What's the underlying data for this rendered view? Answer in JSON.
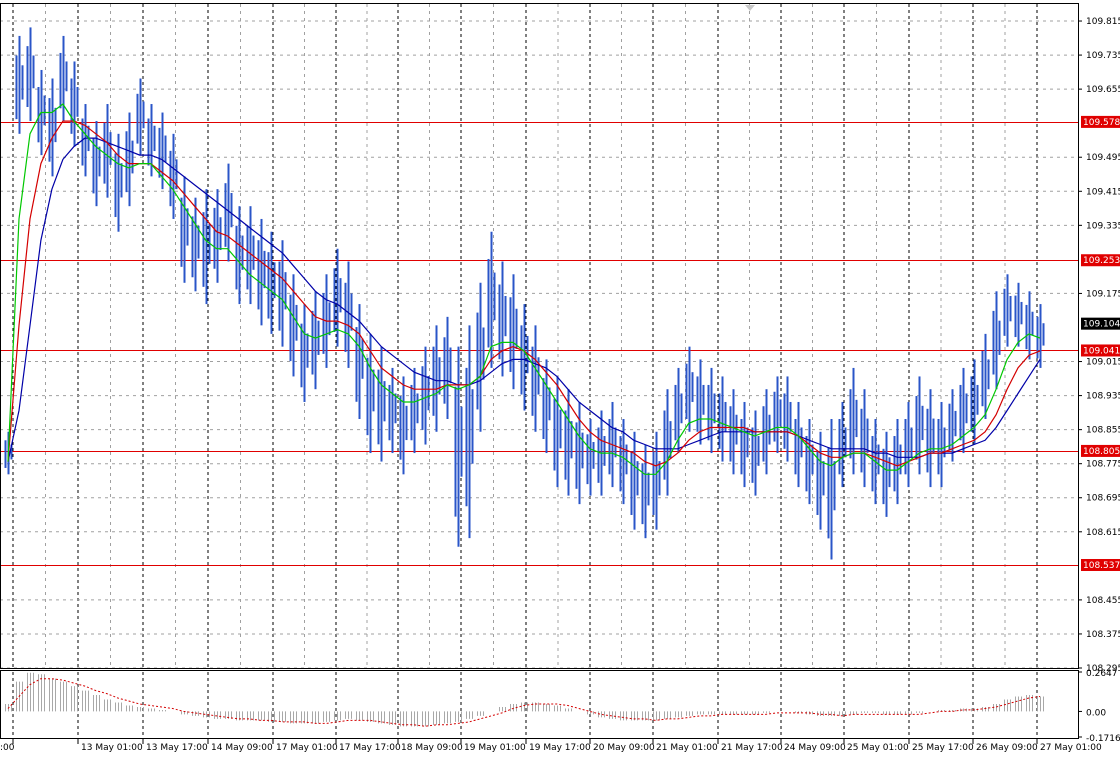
{
  "colors": {
    "background": "#ffffff",
    "frame": "#000000",
    "grid": "#a0a0a0",
    "candle_body": "#2a55c8",
    "ma_fast": "#00c800",
    "ma_medium": "#d40000",
    "ma_slow": "#0000a8",
    "level_line": "#e00000",
    "level_label_bg": "#e00000",
    "level_label_text": "#ffffff",
    "current_price_bg": "#000000",
    "current_price_text": "#ffffff",
    "histogram": "#a8a8a8",
    "signal": "#d40000"
  },
  "chart_data": [
    {
      "type": "line",
      "description_type": "candlestick price chart with three moving averages and horizontal levels",
      "ylim": [
        108.295,
        109.855
      ],
      "y_ticks": [
        "109.815",
        "109.735",
        "109.655",
        "109.495",
        "109.415",
        "109.335",
        "109.175",
        "109.015",
        "108.935",
        "108.855",
        "108.775",
        "108.695",
        "108.615",
        "108.455",
        "108.375",
        "108.295"
      ],
      "x_ticks": [
        ":00",
        "13 May 01:00",
        "13 May 17:00",
        "14 May 09:00",
        "17 May 01:00",
        "17 May 17:00",
        "18 May 09:00",
        "19 May 01:00",
        "19 May 17:00",
        "20 May 09:00",
        "21 May 01:00",
        "21 May 17:00",
        "24 May 09:00",
        "25 May 01:00",
        "25 May 17:00",
        "26 May 09:00",
        "27 May 01:00"
      ],
      "grid": true,
      "levels": [
        {
          "label": "109.578",
          "value": 109.578
        },
        {
          "label": "109.253",
          "value": 109.253
        },
        {
          "label": "109.041",
          "value": 109.041
        },
        {
          "label": "108.805",
          "value": 108.805
        },
        {
          "label": "108.537",
          "value": 108.537
        }
      ],
      "current_price": {
        "label": "109.104",
        "value": 109.104
      },
      "close": [
        108.78,
        109.6,
        109.68,
        109.62,
        109.58,
        109.7,
        109.64,
        109.55,
        109.5,
        109.52,
        109.42,
        109.48,
        109.6,
        109.55,
        109.52,
        109.48,
        109.35,
        109.3,
        109.3,
        109.32,
        109.38,
        109.3,
        109.28,
        109.25,
        109.22,
        109.18,
        109.1,
        109.05,
        109.1,
        109.15,
        109.2,
        109.15,
        109.05,
        108.95,
        108.9,
        108.92,
        108.88,
        108.9,
        108.95,
        108.98,
        109.0,
        108.92,
        108.95,
        109.05,
        109.2,
        109.15,
        109.1,
        109.05,
        108.98,
        108.92,
        108.88,
        108.85,
        108.8,
        108.78,
        108.8,
        108.82,
        108.78,
        108.75,
        108.7,
        108.72,
        108.8,
        108.9,
        108.95,
        108.92,
        108.9,
        108.88,
        108.85,
        108.83,
        108.82,
        108.85,
        108.9,
        108.88,
        108.82,
        108.78,
        108.75,
        108.77,
        108.82,
        108.85,
        108.82,
        108.76,
        108.73,
        108.75,
        108.8,
        108.85,
        108.82,
        108.8,
        108.84,
        108.88,
        108.9,
        108.95,
        109.05,
        109.15,
        109.12,
        109.08,
        109.06
      ],
      "ma_fast": [
        108.78,
        109.35,
        109.55,
        109.6,
        109.6,
        109.62,
        109.58,
        109.55,
        109.52,
        109.5,
        109.48,
        109.47,
        109.48,
        109.48,
        109.45,
        109.42,
        109.38,
        109.34,
        109.3,
        109.28,
        109.28,
        109.25,
        109.22,
        109.2,
        109.18,
        109.16,
        109.12,
        109.08,
        109.07,
        109.08,
        109.09,
        109.08,
        109.05,
        109.0,
        108.96,
        108.94,
        108.92,
        108.92,
        108.93,
        108.94,
        108.96,
        108.95,
        108.96,
        108.98,
        109.05,
        109.06,
        109.06,
        109.04,
        109.0,
        108.96,
        108.92,
        108.88,
        108.84,
        108.81,
        108.8,
        108.8,
        108.79,
        108.77,
        108.75,
        108.75,
        108.78,
        108.83,
        108.87,
        108.88,
        108.88,
        108.87,
        108.86,
        108.85,
        108.84,
        108.85,
        108.86,
        108.86,
        108.84,
        108.81,
        108.78,
        108.77,
        108.79,
        108.8,
        108.8,
        108.78,
        108.76,
        108.76,
        108.78,
        108.8,
        108.81,
        108.81,
        108.82,
        108.84,
        108.86,
        108.89,
        108.95,
        109.02,
        109.06,
        109.08,
        109.07
      ],
      "ma_medium": [
        108.78,
        109.1,
        109.35,
        109.48,
        109.54,
        109.58,
        109.58,
        109.57,
        109.55,
        109.53,
        109.5,
        109.48,
        109.48,
        109.48,
        109.46,
        109.44,
        109.41,
        109.38,
        109.35,
        109.32,
        109.31,
        109.29,
        109.27,
        109.25,
        109.23,
        109.21,
        109.18,
        109.15,
        109.12,
        109.11,
        109.11,
        109.1,
        109.08,
        109.04,
        109.0,
        108.98,
        108.96,
        108.95,
        108.95,
        108.95,
        108.96,
        108.96,
        108.96,
        108.98,
        109.02,
        109.04,
        109.05,
        109.04,
        109.02,
        108.99,
        108.96,
        108.92,
        108.88,
        108.85,
        108.83,
        108.82,
        108.81,
        108.8,
        108.78,
        108.77,
        108.78,
        108.8,
        108.83,
        108.85,
        108.86,
        108.86,
        108.86,
        108.86,
        108.85,
        108.85,
        108.85,
        108.85,
        108.84,
        108.82,
        108.8,
        108.79,
        108.79,
        108.8,
        108.8,
        108.79,
        108.78,
        108.77,
        108.78,
        108.79,
        108.8,
        108.8,
        108.81,
        108.82,
        108.83,
        108.85,
        108.89,
        108.95,
        109.0,
        109.03,
        109.04
      ],
      "ma_slow": [
        108.78,
        108.9,
        109.1,
        109.3,
        109.42,
        109.49,
        109.52,
        109.54,
        109.54,
        109.53,
        109.52,
        109.51,
        109.5,
        109.5,
        109.49,
        109.47,
        109.45,
        109.43,
        109.41,
        109.39,
        109.37,
        109.35,
        109.33,
        109.31,
        109.29,
        109.27,
        109.24,
        109.21,
        109.18,
        109.16,
        109.15,
        109.13,
        109.11,
        109.08,
        109.05,
        109.03,
        109.01,
        108.99,
        108.98,
        108.97,
        108.97,
        108.96,
        108.96,
        108.97,
        108.99,
        109.01,
        109.02,
        109.02,
        109.01,
        109.0,
        108.98,
        108.95,
        108.92,
        108.9,
        108.88,
        108.86,
        108.85,
        108.83,
        108.82,
        108.81,
        108.81,
        108.81,
        108.82,
        108.83,
        108.84,
        108.85,
        108.85,
        108.85,
        108.85,
        108.85,
        108.85,
        108.85,
        108.84,
        108.83,
        108.82,
        108.81,
        108.81,
        108.81,
        108.81,
        108.8,
        108.8,
        108.79,
        108.79,
        108.79,
        108.8,
        108.8,
        108.8,
        108.81,
        108.82,
        108.83,
        108.86,
        108.9,
        108.94,
        108.98,
        109.02
      ],
      "candle_range": [
        [
          108.75,
          108.85
        ],
        [
          109.55,
          109.78
        ],
        [
          109.58,
          109.8
        ],
        [
          109.5,
          109.7
        ],
        [
          109.45,
          109.68
        ],
        [
          109.58,
          109.78
        ],
        [
          109.52,
          109.72
        ],
        [
          109.45,
          109.62
        ],
        [
          109.38,
          109.58
        ],
        [
          109.4,
          109.62
        ],
        [
          109.32,
          109.55
        ],
        [
          109.38,
          109.6
        ],
        [
          109.5,
          109.68
        ],
        [
          109.45,
          109.62
        ],
        [
          109.42,
          109.6
        ],
        [
          109.35,
          109.55
        ],
        [
          109.2,
          109.45
        ],
        [
          109.18,
          109.4
        ],
        [
          109.15,
          109.42
        ],
        [
          109.2,
          109.42
        ],
        [
          109.25,
          109.48
        ],
        [
          109.15,
          109.38
        ],
        [
          109.15,
          109.38
        ],
        [
          109.1,
          109.35
        ],
        [
          109.08,
          109.32
        ],
        [
          109.05,
          109.3
        ],
        [
          108.98,
          109.22
        ],
        [
          108.92,
          109.15
        ],
        [
          108.95,
          109.18
        ],
        [
          109.0,
          109.22
        ],
        [
          109.05,
          109.28
        ],
        [
          109.0,
          109.25
        ],
        [
          108.88,
          109.15
        ],
        [
          108.8,
          109.08
        ],
        [
          108.78,
          109.05
        ],
        [
          108.8,
          109.0
        ],
        [
          108.75,
          108.98
        ],
        [
          108.8,
          109.0
        ],
        [
          108.82,
          109.05
        ],
        [
          108.85,
          109.1
        ],
        [
          108.88,
          109.12
        ],
        [
          108.58,
          109.05
        ],
        [
          108.6,
          109.1
        ],
        [
          108.85,
          109.2
        ],
        [
          109.0,
          109.32
        ],
        [
          108.98,
          109.25
        ],
        [
          108.95,
          109.22
        ],
        [
          108.9,
          109.15
        ],
        [
          108.85,
          109.1
        ],
        [
          108.8,
          109.02
        ],
        [
          108.72,
          108.98
        ],
        [
          108.7,
          108.95
        ],
        [
          108.68,
          108.92
        ],
        [
          108.7,
          108.88
        ],
        [
          108.7,
          108.9
        ],
        [
          108.72,
          108.92
        ],
        [
          108.68,
          108.88
        ],
        [
          108.62,
          108.85
        ],
        [
          108.6,
          108.82
        ],
        [
          108.62,
          108.85
        ],
        [
          108.7,
          108.95
        ],
        [
          108.8,
          109.0
        ],
        [
          108.85,
          109.05
        ],
        [
          108.82,
          109.02
        ],
        [
          108.8,
          109.0
        ],
        [
          108.78,
          108.98
        ],
        [
          108.75,
          108.95
        ],
        [
          108.72,
          108.92
        ],
        [
          108.7,
          108.9
        ],
        [
          108.75,
          108.95
        ],
        [
          108.8,
          108.98
        ],
        [
          108.78,
          108.98
        ],
        [
          108.72,
          108.92
        ],
        [
          108.68,
          108.88
        ],
        [
          108.62,
          108.85
        ],
        [
          108.55,
          108.88
        ],
        [
          108.72,
          108.92
        ],
        [
          108.75,
          109.0
        ],
        [
          108.72,
          108.95
        ],
        [
          108.68,
          108.88
        ],
        [
          108.65,
          108.85
        ],
        [
          108.68,
          108.88
        ],
        [
          108.72,
          108.92
        ],
        [
          108.75,
          108.98
        ],
        [
          108.72,
          108.95
        ],
        [
          108.72,
          108.92
        ],
        [
          108.78,
          108.95
        ],
        [
          108.8,
          109.0
        ],
        [
          108.82,
          109.02
        ],
        [
          108.88,
          109.08
        ],
        [
          108.95,
          109.18
        ],
        [
          109.05,
          109.22
        ],
        [
          109.05,
          109.2
        ],
        [
          109.02,
          109.18
        ],
        [
          109.0,
          109.15
        ]
      ]
    },
    {
      "type": "bar",
      "description_type": "oscillator histogram with signal line",
      "ylim": [
        -0.1716,
        0.2647
      ],
      "y_ticks": [
        "0.2647",
        "0.00",
        "-0.1716"
      ],
      "histogram": [
        0.05,
        0.2,
        0.26,
        0.25,
        0.22,
        0.2,
        0.17,
        0.14,
        0.11,
        0.08,
        0.06,
        0.04,
        0.03,
        0.02,
        0.01,
        0.0,
        -0.02,
        -0.03,
        -0.04,
        -0.05,
        -0.05,
        -0.06,
        -0.06,
        -0.06,
        -0.07,
        -0.07,
        -0.08,
        -0.08,
        -0.08,
        -0.07,
        -0.06,
        -0.05,
        -0.06,
        -0.07,
        -0.08,
        -0.09,
        -0.1,
        -0.1,
        -0.1,
        -0.09,
        -0.08,
        -0.07,
        -0.05,
        -0.03,
        0.0,
        0.03,
        0.05,
        0.06,
        0.06,
        0.05,
        0.04,
        0.02,
        0.0,
        -0.02,
        -0.04,
        -0.05,
        -0.06,
        -0.06,
        -0.06,
        -0.06,
        -0.05,
        -0.04,
        -0.03,
        -0.02,
        -0.02,
        -0.02,
        -0.02,
        -0.02,
        -0.02,
        -0.01,
        0.0,
        0.0,
        -0.01,
        -0.02,
        -0.03,
        -0.03,
        -0.03,
        -0.02,
        -0.01,
        -0.01,
        -0.02,
        -0.02,
        -0.02,
        -0.01,
        0.0,
        0.01,
        0.01,
        0.02,
        0.02,
        0.03,
        0.05,
        0.08,
        0.1,
        0.11,
        0.1
      ],
      "signal": [
        0.02,
        0.1,
        0.18,
        0.22,
        0.22,
        0.21,
        0.19,
        0.17,
        0.14,
        0.12,
        0.09,
        0.07,
        0.05,
        0.04,
        0.03,
        0.02,
        0.0,
        -0.01,
        -0.02,
        -0.03,
        -0.04,
        -0.05,
        -0.05,
        -0.06,
        -0.06,
        -0.07,
        -0.07,
        -0.07,
        -0.08,
        -0.08,
        -0.07,
        -0.06,
        -0.06,
        -0.06,
        -0.07,
        -0.08,
        -0.09,
        -0.09,
        -0.1,
        -0.09,
        -0.09,
        -0.08,
        -0.07,
        -0.05,
        -0.03,
        -0.01,
        0.02,
        0.04,
        0.05,
        0.05,
        0.05,
        0.04,
        0.02,
        0.0,
        -0.02,
        -0.03,
        -0.04,
        -0.05,
        -0.05,
        -0.06,
        -0.05,
        -0.05,
        -0.04,
        -0.03,
        -0.03,
        -0.02,
        -0.02,
        -0.02,
        -0.02,
        -0.02,
        -0.01,
        -0.01,
        -0.01,
        -0.01,
        -0.02,
        -0.02,
        -0.03,
        -0.02,
        -0.02,
        -0.02,
        -0.02,
        -0.02,
        -0.02,
        -0.02,
        -0.01,
        0.0,
        0.0,
        0.01,
        0.01,
        0.02,
        0.03,
        0.05,
        0.07,
        0.09,
        0.1
      ]
    }
  ]
}
